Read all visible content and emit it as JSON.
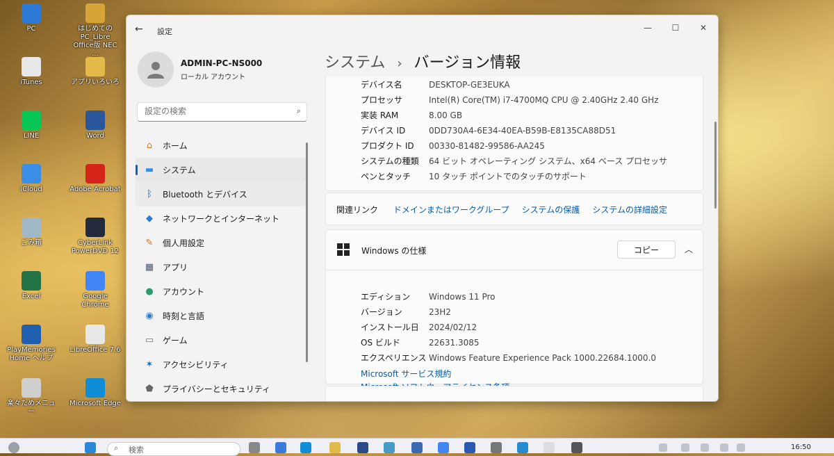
{
  "desktop": {
    "icons": [
      {
        "label": "PC",
        "color": "#2d7ad6"
      },
      {
        "label": "はじめてのPC_Libre Office版 NEC ...",
        "color": "#d7a437"
      },
      {
        "label": "iTunes",
        "color": "#e8e8e8"
      },
      {
        "label": "アプリいろいろ",
        "color": "#e3b94a"
      },
      {
        "label": "LINE",
        "color": "#06c755"
      },
      {
        "label": "Word",
        "color": "#2b579a"
      },
      {
        "label": "iCloud",
        "color": "#3a8ee6"
      },
      {
        "label": "Adobe Acrobat",
        "color": "#d4241a"
      },
      {
        "label": "ごみ箱",
        "color": "#a0b8c8"
      },
      {
        "label": "CyberLink PowerDVD 12",
        "color": "#222a3c"
      },
      {
        "label": "Excel",
        "color": "#217346"
      },
      {
        "label": "Google Chrome",
        "color": "#4285f4"
      },
      {
        "label": "PlayMemories Home ヘルプ",
        "color": "#1f5fb0"
      },
      {
        "label": "LibreOffice 7.6",
        "color": "#e8e8e8"
      },
      {
        "label": "楽々ためメニュー",
        "color": "#cfcfcf"
      },
      {
        "label": "Microsoft Edge",
        "color": "#0f8dd6"
      }
    ]
  },
  "window": {
    "title": "設定",
    "minimize": "—",
    "maximize": "☐",
    "close": "✕"
  },
  "user": {
    "name": "ADMIN-PC-NS000",
    "account_type": "ローカル アカウント"
  },
  "search": {
    "placeholder": "設定の検索"
  },
  "sidebar": {
    "items": [
      {
        "label": "ホーム",
        "icon": "home-icon",
        "color": "#c87a2a"
      },
      {
        "label": "システム",
        "icon": "system-icon",
        "color": "#3a8ee6"
      },
      {
        "label": "Bluetooth とデバイス",
        "icon": "bluetooth-icon",
        "color": "#0067c0"
      },
      {
        "label": "ネットワークとインターネット",
        "icon": "network-icon",
        "color": "#2a7ad0"
      },
      {
        "label": "個人用設定",
        "icon": "brush-icon",
        "color": "#c0762a"
      },
      {
        "label": "アプリ",
        "icon": "apps-icon",
        "color": "#4a5a70"
      },
      {
        "label": "アカウント",
        "icon": "account-icon",
        "color": "#2a9d6a"
      },
      {
        "label": "時刻と言語",
        "icon": "globe-icon",
        "color": "#2a7ad0"
      },
      {
        "label": "ゲーム",
        "icon": "game-icon",
        "color": "#777777"
      },
      {
        "label": "アクセシビリティ",
        "icon": "accessibility-icon",
        "color": "#1a6ab8"
      },
      {
        "label": "プライバシーとセキュリティ",
        "icon": "shield-icon",
        "color": "#666666"
      }
    ]
  },
  "header": {
    "parent": "システム",
    "separator": "›",
    "title": "バージョン情報"
  },
  "device_specs": {
    "rows": [
      {
        "key": "デバイス名",
        "value": "DESKTOP-GE3EUKA"
      },
      {
        "key": "プロセッサ",
        "value": "Intel(R) Core(TM) i7-4700MQ CPU @ 2.40GHz   2.40 GHz"
      },
      {
        "key": "実装 RAM",
        "value": "8.00 GB"
      },
      {
        "key": "デバイス ID",
        "value": "0DD730A4-6E34-40EA-B59B-E8135CA88D51"
      },
      {
        "key": "プロダクト ID",
        "value": "00330-81482-99586-AA245"
      },
      {
        "key": "システムの種類",
        "value": "64 ビット オペレーティング システム、x64 ベース プロセッサ"
      },
      {
        "key": "ペンとタッチ",
        "value": "10 タッチ ポイントでのタッチのサポート"
      }
    ]
  },
  "related_links": {
    "label": "関連リンク",
    "links": [
      "ドメインまたはワークグループ",
      "システムの保護",
      "システムの詳細設定"
    ]
  },
  "windows_spec": {
    "title": "Windows の仕様",
    "copy_label": "コピー",
    "rows": [
      {
        "key": "エディション",
        "value": "Windows 11 Pro"
      },
      {
        "key": "バージョン",
        "value": "23H2"
      },
      {
        "key": "インストール日",
        "value": "2024/02/12"
      },
      {
        "key": "OS ビルド",
        "value": "22631.3085"
      },
      {
        "key": "エクスペリエンス",
        "value": "Windows Feature Experience Pack 1000.22684.1000.0"
      }
    ],
    "links": [
      "Microsoft サービス規約",
      "Microsoft ソフトウェアライセンス条項"
    ]
  },
  "taskbar": {
    "search_placeholder": "検索",
    "time": "16:50"
  }
}
